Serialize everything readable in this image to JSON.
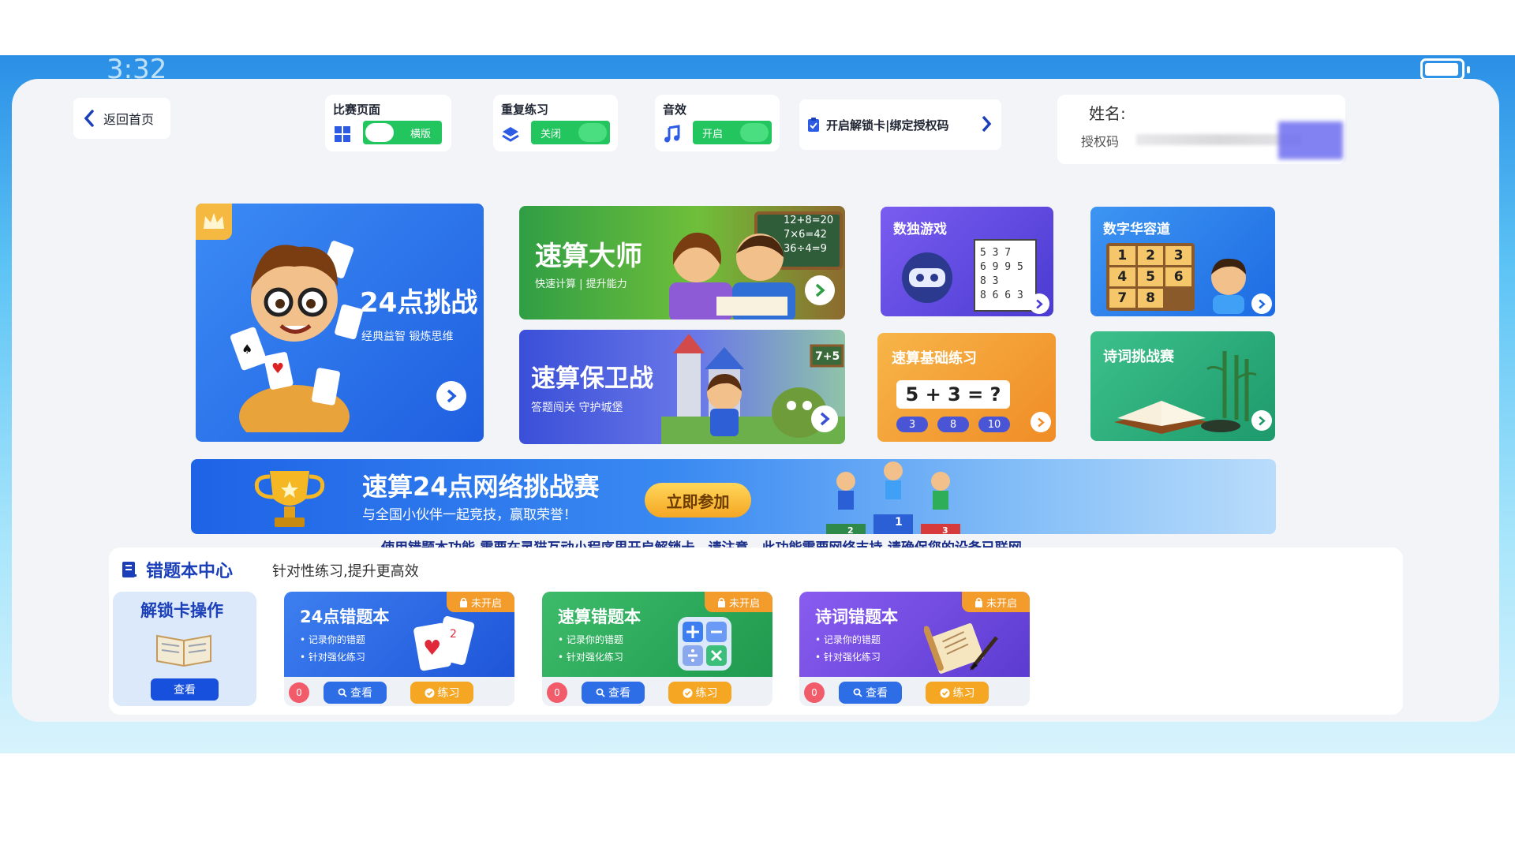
{
  "status": {
    "time": "3:32"
  },
  "header": {
    "back_label": "返回首页",
    "toggles": [
      {
        "label": "比赛页面",
        "value": "横版"
      },
      {
        "label": "重复练习",
        "value": "关闭"
      },
      {
        "label": "音效",
        "value": "开启"
      }
    ],
    "unlock_label": "开启解锁卡|绑定授权码",
    "name_label": "姓名:",
    "auth_label": "授权码"
  },
  "cards": {
    "c24": {
      "title": "24点挑战",
      "subtitle": "经典益智  锻炼思维"
    },
    "master": {
      "title": "速算大师",
      "subtitle": "快速计算 | 提升能力",
      "board": "12+8=20\n7×6=42\n36÷4=9"
    },
    "sudoku": {
      "title": "数独游戏"
    },
    "huarong": {
      "title": "数字华容道",
      "tiles": [
        "1",
        "2",
        "3",
        "4",
        "5",
        "6",
        "7",
        "8"
      ]
    },
    "defense": {
      "title": "速算保卫战",
      "subtitle": "答题闯关  守护城堡",
      "sign": "7+5"
    },
    "basic": {
      "title": "速算基础练习",
      "equation": "5 + 3 = ?",
      "options": [
        "3",
        "8",
        "10"
      ]
    },
    "poem": {
      "title": "诗词挑战赛"
    }
  },
  "banner": {
    "title": "速算24点网络挑战赛",
    "subtitle": "与全国小伙伴一起竞技，赢取荣誉！",
    "button": "立即参加",
    "podium": [
      "2",
      "1",
      "3"
    ]
  },
  "notice": "使用错题本功能,需要在灵猫互动小程序里开启解锁卡。请注意，此功能需要网络支持,请确保您的设备已联网。",
  "mistakes": {
    "title": "错题本中心",
    "subtitle": "针对性练习,提升更高效",
    "unlock_op": {
      "title": "解锁卡操作",
      "button": "查看"
    },
    "items": [
      {
        "title": "24点错题本",
        "b1": "• 记录你的错题",
        "b2": "• 针对强化练习",
        "lock": "未开启",
        "count": "0",
        "view": "查看",
        "practice": "练习"
      },
      {
        "title": "速算错题本",
        "b1": "• 记录你的错题",
        "b2": "• 针对强化练习",
        "lock": "未开启",
        "count": "0",
        "view": "查看",
        "practice": "练习"
      },
      {
        "title": "诗词错题本",
        "b1": "• 记录你的错题",
        "b2": "• 针对强化练习",
        "lock": "未开启",
        "count": "0",
        "view": "查看",
        "practice": "练习"
      }
    ]
  }
}
